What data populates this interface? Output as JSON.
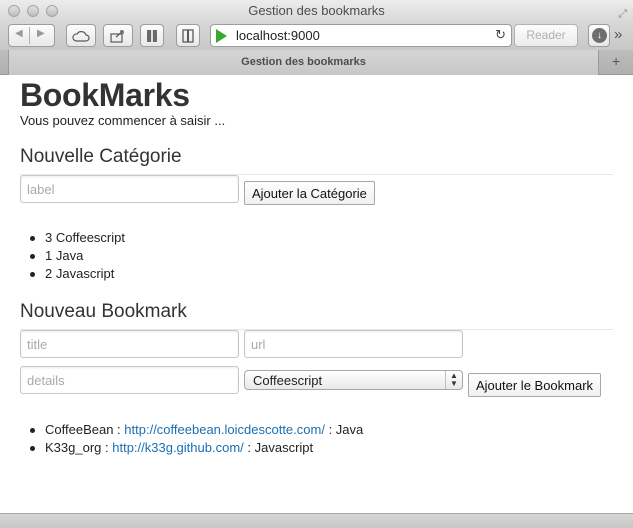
{
  "window": {
    "title": "Gestion des bookmarks"
  },
  "toolbar": {
    "url": "localhost:9000",
    "reader_label": "Reader"
  },
  "tab": {
    "title": "Gestion des bookmarks"
  },
  "page": {
    "title": "BookMarks",
    "subtitle": "Vous pouvez commencer à saisir ...",
    "category_section": {
      "heading": "Nouvelle Catégorie",
      "label_placeholder": "label",
      "add_button": "Ajouter la Catégorie",
      "categories": [
        {
          "count": "3",
          "name": "Coffeescript"
        },
        {
          "count": "1",
          "name": "Java"
        },
        {
          "count": "2",
          "name": "Javascript"
        }
      ]
    },
    "bookmark_section": {
      "heading": "Nouveau Bookmark",
      "title_placeholder": "title",
      "url_placeholder": "url",
      "details_placeholder": "details",
      "category_selected": "Coffeescript",
      "add_button": "Ajouter le Bookmark",
      "bookmarks": [
        {
          "title": "CoffeeBean",
          "url": "http://coffeebean.loicdescotte.com/",
          "category": "Java"
        },
        {
          "title": "K33g_org",
          "url": "http://k33g.github.com/",
          "category": "Javascript"
        }
      ]
    }
  }
}
